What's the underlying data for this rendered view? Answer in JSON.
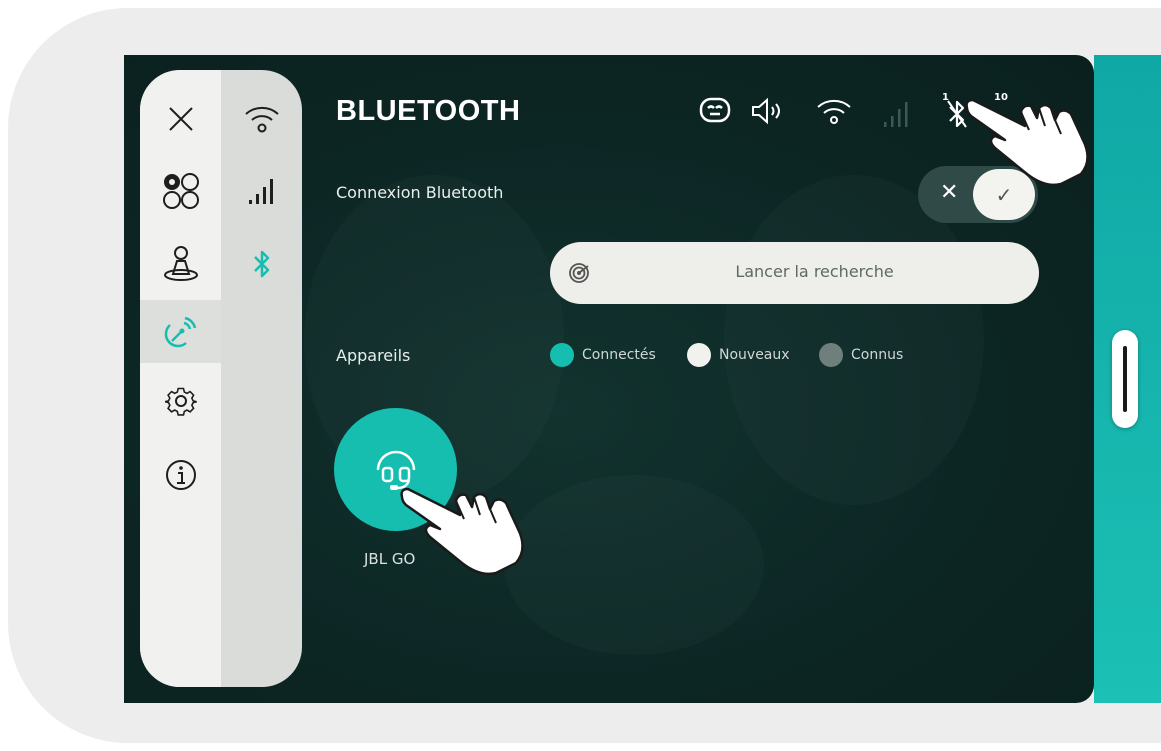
{
  "header": {
    "title": "BLUETOOTH",
    "status_icons": [
      "robot-face-icon",
      "speaker-icon",
      "wifi-icon",
      "signal-icon",
      "bluetooth-off-icon"
    ],
    "bt_counter": "1",
    "battery_counter": "10"
  },
  "sidebar": {
    "column1": [
      {
        "name": "close-icon",
        "active": false
      },
      {
        "name": "apps-icon",
        "active": false
      },
      {
        "name": "user-icon",
        "active": false
      },
      {
        "name": "connectivity-icon",
        "active": true
      },
      {
        "name": "settings-icon",
        "active": false
      },
      {
        "name": "info-icon",
        "active": false
      }
    ],
    "column2": [
      {
        "name": "wifi-icon",
        "active": false
      },
      {
        "name": "cellular-signal-icon",
        "active": false
      },
      {
        "name": "bluetooth-icon",
        "active": true
      }
    ]
  },
  "bluetooth_connection": {
    "label": "Connexion Bluetooth",
    "toggle_off_symbol": "✕",
    "toggle_on_symbol": "✓",
    "enabled": true
  },
  "search": {
    "label": "Lancer la recherche"
  },
  "devices": {
    "label": "Appareils",
    "legend": [
      {
        "label": "Connectés",
        "color": "#16beb0"
      },
      {
        "label": "Nouveaux",
        "color": "#f1f1ee"
      },
      {
        "label": "Connus",
        "color": "#6f7f7c"
      }
    ],
    "items": [
      {
        "name": "JBL GO",
        "status": "Connectés",
        "icon": "headset-icon"
      }
    ]
  },
  "colors": {
    "accent": "#16beb0",
    "screen_bg": "#0c2624",
    "teal_strip": "#1cc0b4"
  }
}
